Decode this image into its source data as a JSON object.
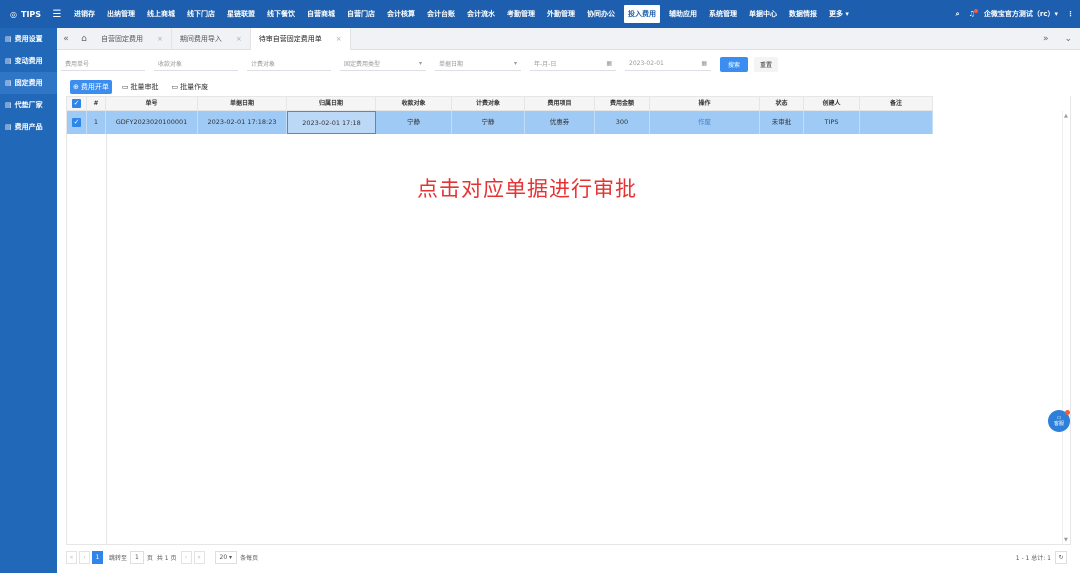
{
  "topbar": {
    "logo": "TIPS",
    "menu_icon": "☰",
    "nav": [
      "进销存",
      "出纳管理",
      "线上商城",
      "线下门店",
      "星链联盟",
      "线下餐饮",
      "自营商城",
      "自营门店",
      "会计核算",
      "会计台账",
      "会计流水",
      "考勤管理",
      "外勤管理",
      "协同办公",
      "投入费用",
      "辅助应用",
      "系统管理",
      "单据中心",
      "数据情报",
      "更多 ▾"
    ],
    "active_nav_index": 14,
    "user": "企微宝官方测试（rc）▾"
  },
  "sidebar": {
    "items": [
      {
        "label": "费用设置"
      },
      {
        "label": "变动费用"
      },
      {
        "label": "固定费用"
      },
      {
        "label": "代垫厂家"
      },
      {
        "label": "费用产品"
      }
    ],
    "active_index": 2
  },
  "tabs": {
    "items": [
      {
        "label": "自营固定费用"
      },
      {
        "label": "期间费用导入"
      },
      {
        "label": "待审自营固定费用单"
      }
    ],
    "active_index": 2
  },
  "filters": {
    "bill_no_placeholder": "费用单号",
    "payee_placeholder": "收款对象",
    "cost_target_placeholder": "计费对象",
    "fee_type_placeholder": "固定费用类型",
    "date_type_value": "单据日期",
    "start_date_placeholder": "年-月-日",
    "end_date_value": "2023-02-01",
    "search_label": "搜索",
    "reset_label": "重置"
  },
  "toolbar": {
    "open_bill": "费用开单",
    "batch_approve": "批量审批",
    "batch_void": "批量作废"
  },
  "table": {
    "columns": [
      "#",
      "单号",
      "单据日期",
      "归属日期",
      "收款对象",
      "计费对象",
      "费用项目",
      "费用金额",
      "操作",
      "状态",
      "创建人",
      "备注"
    ],
    "rows": [
      {
        "index": "1",
        "bill_no": "GDFY2023020100001",
        "bill_date": "2023-02-01 17:18:23",
        "belong_date": "2023-02-01 17:18",
        "payee": "宁静",
        "cost_target": "宁静",
        "fee_item": "优惠券",
        "amount": "300",
        "action": "作废",
        "status": "未审批",
        "creator": "TIPS",
        "remark": ""
      }
    ]
  },
  "overlay_text": "点击对应单据进行审批",
  "pager": {
    "current_page": "1",
    "goto_label": "跳转至",
    "goto_value": "1",
    "page_label": "页",
    "total_pages": "共 1 页",
    "page_size": "20",
    "per_page_label": "条每页",
    "summary": "1 - 1 总计: 1"
  },
  "service": {
    "label": "客服"
  },
  "colors": {
    "topbar": "#1d5fae",
    "sidebar": "#2268b8",
    "primary": "#3b8ef0",
    "selected_row": "#9fcaf6",
    "overlay": "#e53333"
  }
}
